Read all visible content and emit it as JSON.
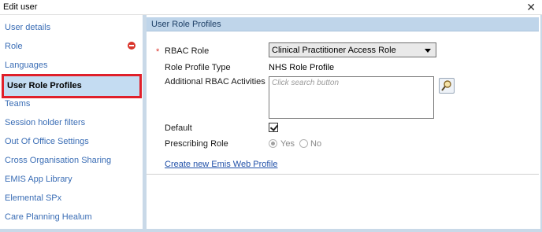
{
  "window": {
    "title": "Edit user",
    "close_glyph": "✕"
  },
  "sidebar": {
    "items": [
      {
        "label": "User details"
      },
      {
        "label": "Role",
        "error_icon": "error-icon"
      },
      {
        "label": "Languages"
      },
      {
        "label": "User Role Profiles",
        "active": true
      },
      {
        "label": "Teams"
      },
      {
        "label": "Session holder filters"
      },
      {
        "label": "Out Of Office Settings"
      },
      {
        "label": "Cross Organisation Sharing"
      },
      {
        "label": "EMIS App Library"
      },
      {
        "label": "Elemental SPx"
      },
      {
        "label": "Care Planning Healum"
      }
    ]
  },
  "panel": {
    "header": "User Role Profiles",
    "rbac_role": {
      "required_mark": "*",
      "label": "RBAC Role",
      "value": "Clinical Practitioner Access Role"
    },
    "role_profile_type": {
      "label": "Role Profile Type",
      "value": "NHS Role Profile"
    },
    "additional_rbac": {
      "label": "Additional RBAC Activities",
      "placeholder": "Click search button",
      "search_icon": "magnifier-icon"
    },
    "default": {
      "label": "Default",
      "checked": true
    },
    "prescribing_role": {
      "label": "Prescribing Role",
      "yes_label": "Yes",
      "no_label": "No",
      "selected": "Yes",
      "disabled": true
    },
    "create_link": "Create new Emis Web Profile"
  },
  "colors": {
    "accent_blue": "#3a6db5",
    "header_blue": "#bfd5ea",
    "active_fill": "#c4dcf2",
    "active_border": "#e0202a",
    "error_red": "#d9342b"
  }
}
